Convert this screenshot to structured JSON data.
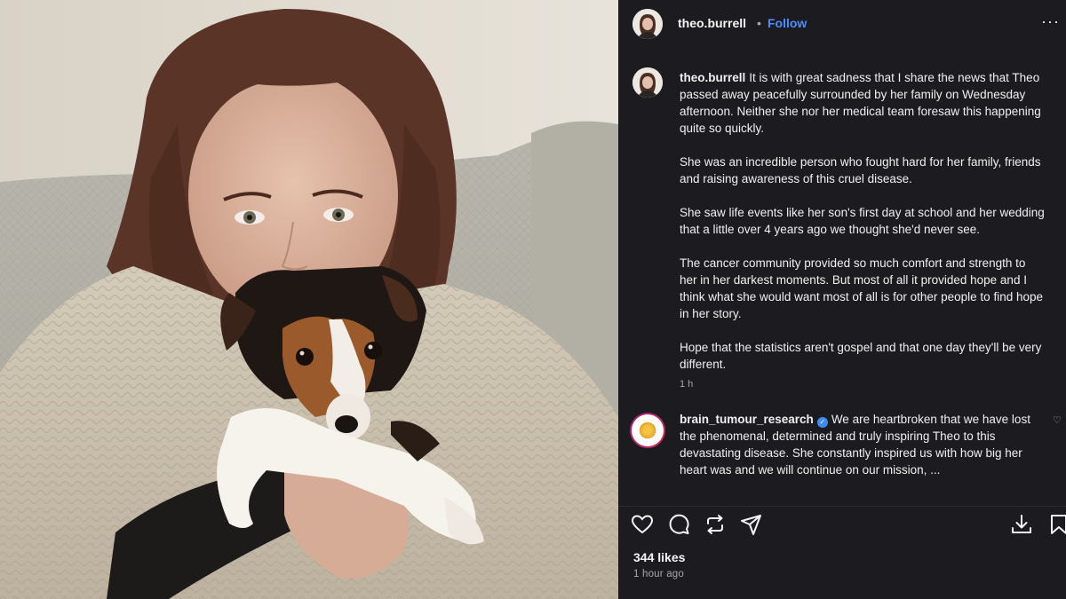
{
  "post": {
    "username": "theo.burrell",
    "separator": "•",
    "follow_label": "Follow",
    "more_icon": "more-options-icon",
    "more_label": "···"
  },
  "caption": {
    "author": "theo.burrell",
    "paragraphs": [
      "It is with great sadness that I share the news that Theo passed away peacefully surrounded by her family on Wednesday afternoon. Neither she nor her medical team foresaw this happening quite so quickly.",
      "She was an incredible person who fought hard for her family, friends and raising awareness of this cruel disease.",
      "She saw life events like her son's first day at school and her wedding that a little over 4 years ago we thought she'd never see.",
      "The cancer community provided so much comfort and strength to her in her darkest moments. But most of all it provided hope and I think what she would want most of all is for other people to find hope in her story.",
      "Hope that the statistics aren't gospel and that one day they'll be very different."
    ],
    "time": "1 h"
  },
  "reply": {
    "author": "brain_tumour_research",
    "verified_mark": "✓",
    "text": "We are heartbroken that we have lost the phenomenal, determined and truly inspiring Theo to this devastating disease. She constantly inspired us with how big her heart was and we will continue on our mission, ..."
  },
  "actions": {
    "like_icon": "heart-icon",
    "comment_icon": "comment-icon",
    "repost_icon": "repost-icon",
    "share_icon": "share-icon",
    "download_icon": "download-icon",
    "save_icon": "bookmark-icon"
  },
  "stats": {
    "likes": "344 likes",
    "posted": "1 hour ago"
  },
  "colors": {
    "panel_bg": "#1c1c20",
    "accent": "#4c8dff",
    "verified": "#3b8cf5"
  }
}
